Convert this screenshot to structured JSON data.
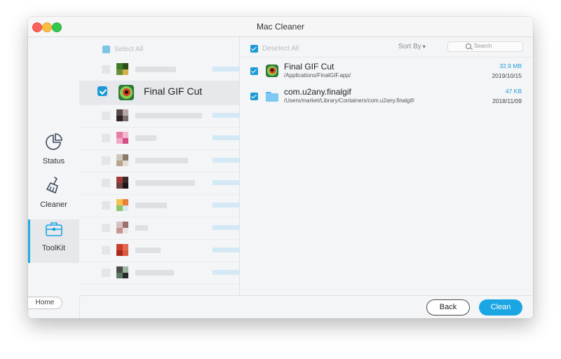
{
  "window": {
    "title": "Mac Cleaner"
  },
  "sidebar": {
    "items": [
      {
        "label": "Status",
        "icon": "pie-chart-icon",
        "active": false
      },
      {
        "label": "Cleaner",
        "icon": "broom-icon",
        "active": false
      },
      {
        "label": "ToolKit",
        "icon": "toolbox-icon",
        "active": true
      }
    ],
    "home_label": "Home"
  },
  "app_list": {
    "select_all_label": "Select All",
    "selected_app": {
      "name": "Final GIF Cut",
      "checked": true
    },
    "blurred_rows": 10
  },
  "detail": {
    "deselect_all_label": "Deselect All",
    "sort_label": "Sort By",
    "search_placeholder": "Search",
    "files": [
      {
        "name": "Final GIF Cut",
        "path": "/Applications/FinalGIF.app/",
        "size": "32.9 MB",
        "date": "2019/10/15",
        "icon": "app-icon",
        "checked": true
      },
      {
        "name": "com.u2any.finalgif",
        "path": "/Users/market/Library/Containers/com.u2any.finalgif/",
        "size": "47 KB",
        "date": "2018/11/09",
        "icon": "folder-icon",
        "checked": true
      }
    ]
  },
  "footer": {
    "back_label": "Back",
    "clean_label": "Clean"
  },
  "colors": {
    "accent": "#1aa6e3",
    "checkbox": "#1d9ad6"
  }
}
